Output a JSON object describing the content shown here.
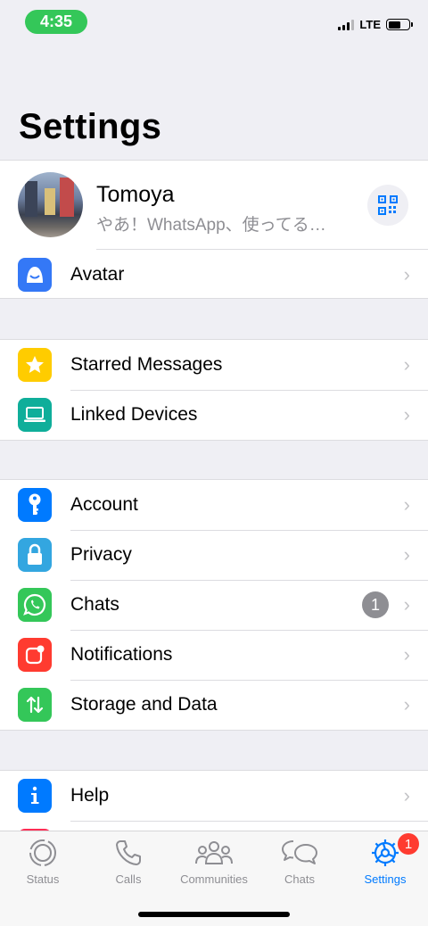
{
  "status_bar": {
    "time": "4:35",
    "network": "LTE"
  },
  "header": {
    "title": "Settings"
  },
  "profile": {
    "name": "Tomoya",
    "status": "やあ！WhatsApp、使ってる…"
  },
  "groups": {
    "avatar": {
      "label": "Avatar"
    },
    "g2": [
      {
        "label": "Starred Messages",
        "color": "#ffcc00",
        "icon": "star-icon"
      },
      {
        "label": "Linked Devices",
        "color": "#0fae9a",
        "icon": "laptop-icon"
      }
    ],
    "g3": [
      {
        "label": "Account",
        "color": "#007aff",
        "icon": "key-icon"
      },
      {
        "label": "Privacy",
        "color": "#33a6e0",
        "icon": "lock-icon"
      },
      {
        "label": "Chats",
        "color": "#34c759",
        "icon": "whatsapp-icon",
        "badge": "1"
      },
      {
        "label": "Notifications",
        "color": "#ff3b30",
        "icon": "notification-icon"
      },
      {
        "label": "Storage and Data",
        "color": "#34c759",
        "icon": "arrows-icon"
      }
    ],
    "g4": [
      {
        "label": "Help",
        "color": "#007aff",
        "icon": "info-icon"
      }
    ]
  },
  "tabbar": {
    "tabs": [
      {
        "label": "Status",
        "icon": "status-icon"
      },
      {
        "label": "Calls",
        "icon": "phone-icon"
      },
      {
        "label": "Communities",
        "icon": "communities-icon"
      },
      {
        "label": "Chats",
        "icon": "chat-bubbles-icon"
      },
      {
        "label": "Settings",
        "icon": "gear-icon",
        "active": true,
        "badge": "1"
      }
    ]
  },
  "colors": {
    "accent": "#007aff",
    "badge_red": "#ff3b30",
    "whatsapp_green": "#34c759"
  }
}
